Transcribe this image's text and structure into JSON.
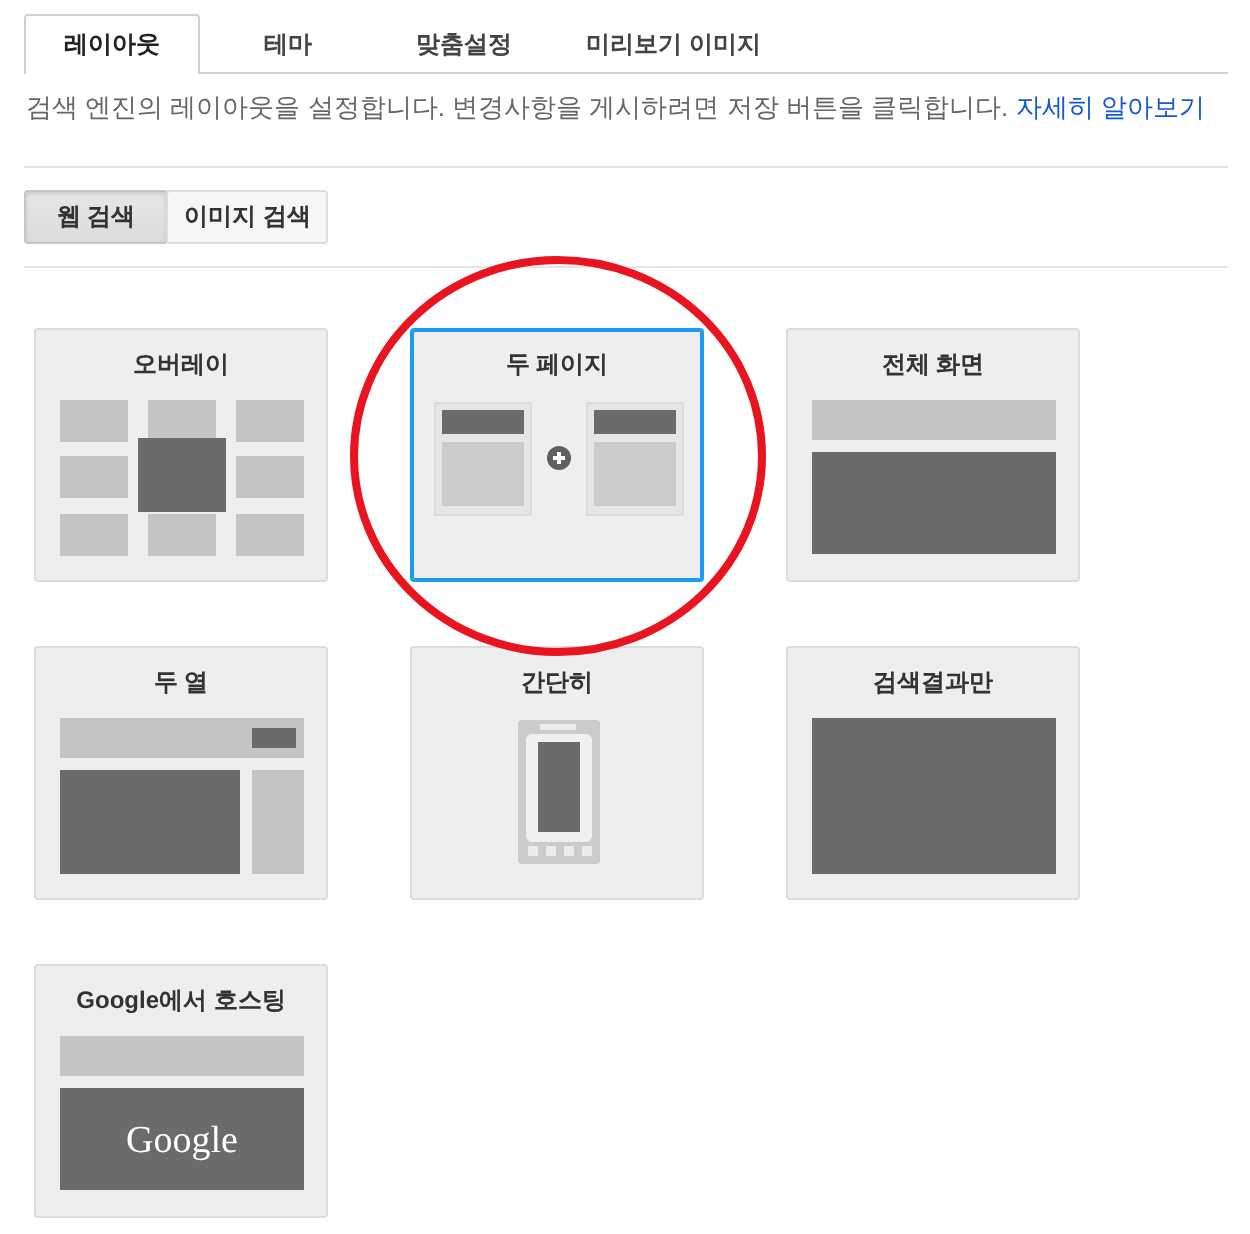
{
  "tabs": [
    {
      "label": "레이아웃",
      "selected": true
    },
    {
      "label": "테마",
      "selected": false
    },
    {
      "label": "맞춤설정",
      "selected": false
    },
    {
      "label": "미리보기 이미지",
      "selected": false
    }
  ],
  "description": {
    "text": "검색 엔진의 레이아웃을 설정합니다. 변경사항을 게시하려면 저장 버튼을 클릭합니다.",
    "link": "자세히 알아보기"
  },
  "search_types": [
    {
      "label": "웹 검색",
      "selected": true
    },
    {
      "label": "이미지 검색",
      "selected": false
    }
  ],
  "layouts": [
    {
      "title": "오버레이",
      "kind": "overlay",
      "selected": false,
      "circled": false
    },
    {
      "title": "두 페이지",
      "kind": "two-page",
      "selected": true,
      "circled": true
    },
    {
      "title": "전체 화면",
      "kind": "full-screen",
      "selected": false,
      "circled": false
    },
    {
      "title": "두 열",
      "kind": "two-column",
      "selected": false,
      "circled": false
    },
    {
      "title": "간단히",
      "kind": "simple",
      "selected": false,
      "circled": false
    },
    {
      "title": "검색결과만",
      "kind": "results-only",
      "selected": false,
      "circled": false
    },
    {
      "title": "Google에서 호스팅",
      "kind": "hosted",
      "logo_text": "Google",
      "selected": false,
      "circled": false
    }
  ]
}
